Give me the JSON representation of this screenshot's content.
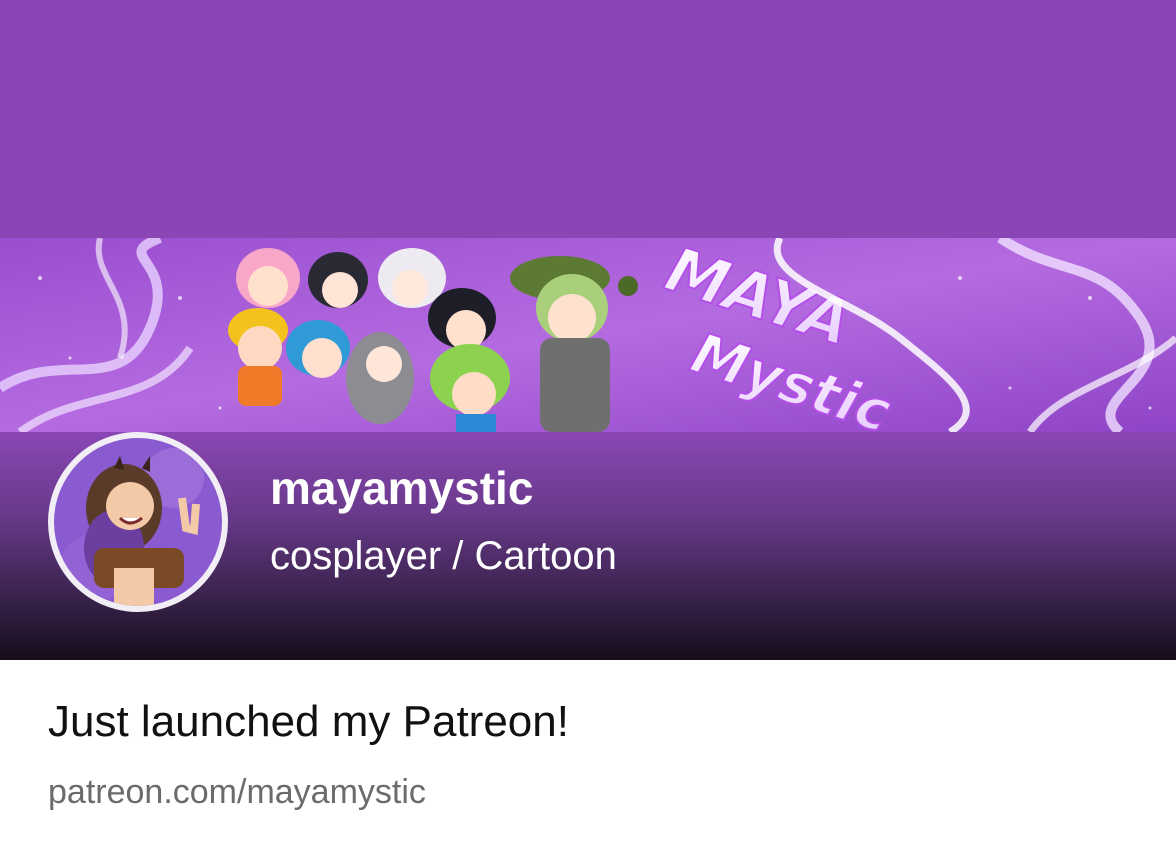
{
  "creator": {
    "name": "mayamystic",
    "category": "cosplayer / Cartoon"
  },
  "banner": {
    "logo_text": "MAYA Mystic"
  },
  "post": {
    "headline": "Just launched my Patreon!",
    "url": "patreon.com/mayamystic"
  },
  "colors": {
    "hero_purple": "#8a46b4",
    "hero_dark": "#150d1b",
    "text_dark": "#111111",
    "url_gray": "#6b6b6b",
    "avatar_ring": "#f2eef6"
  }
}
